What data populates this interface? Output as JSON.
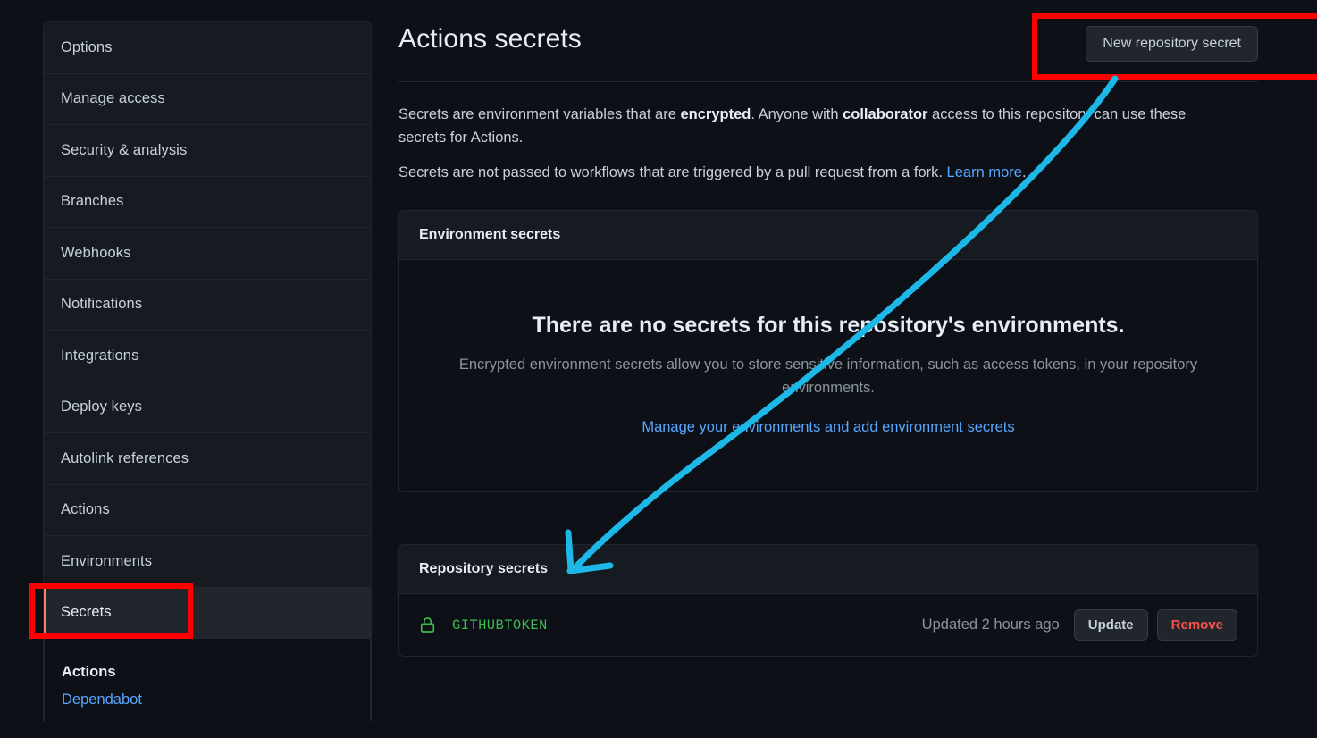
{
  "sidebar": {
    "items": [
      {
        "label": "Options",
        "selected": false
      },
      {
        "label": "Manage access",
        "selected": false
      },
      {
        "label": "Security & analysis",
        "selected": false
      },
      {
        "label": "Branches",
        "selected": false
      },
      {
        "label": "Webhooks",
        "selected": false
      },
      {
        "label": "Notifications",
        "selected": false
      },
      {
        "label": "Integrations",
        "selected": false
      },
      {
        "label": "Deploy keys",
        "selected": false
      },
      {
        "label": "Autolink references",
        "selected": false
      },
      {
        "label": "Actions",
        "selected": false
      },
      {
        "label": "Environments",
        "selected": false
      },
      {
        "label": "Secrets",
        "selected": true
      }
    ],
    "section": {
      "heading": "Actions",
      "link": "Dependabot"
    }
  },
  "main": {
    "title": "Actions secrets",
    "new_secret_button": "New repository secret",
    "intro": {
      "line1_a": "Secrets are environment variables that are ",
      "line1_b": "encrypted",
      "line1_c": ". Anyone with ",
      "line1_d": "collaborator",
      "line1_e": " access to this repository can use these secrets for Actions.",
      "line2_a": "Secrets are not passed to workflows that are triggered by a pull request from a fork. ",
      "line2_link": "Learn more",
      "line2_end": "."
    },
    "environment_panel": {
      "header": "Environment secrets",
      "blank_title": "There are no secrets for this repository's environments.",
      "blank_desc": "Encrypted environment secrets allow you to store sensitive information, such as access tokens, in your repository environments.",
      "blank_link": "Manage your environments and add environment secrets"
    },
    "repository_panel": {
      "header": "Repository secrets",
      "rows": [
        {
          "icon": "lock-icon",
          "name": "GITHUBTOKEN",
          "updated": "Updated 2 hours ago",
          "update_label": "Update",
          "remove_label": "Remove"
        }
      ]
    }
  },
  "annotations": {
    "box_color": "#fe0000",
    "arrow_color": "#1db8e8",
    "highlighted_button": "New repository secret",
    "highlighted_nav_item": "Secrets"
  },
  "colors": {
    "page_background": "#0d1117",
    "panel_background": "#161b22",
    "border": "#21262d",
    "text_primary": "#c9d1d9",
    "text_muted": "#8b949e",
    "link": "#58a6ff",
    "secret_green": "#3fb950",
    "danger_red": "#f85149",
    "nav_accent": "#f78166"
  }
}
